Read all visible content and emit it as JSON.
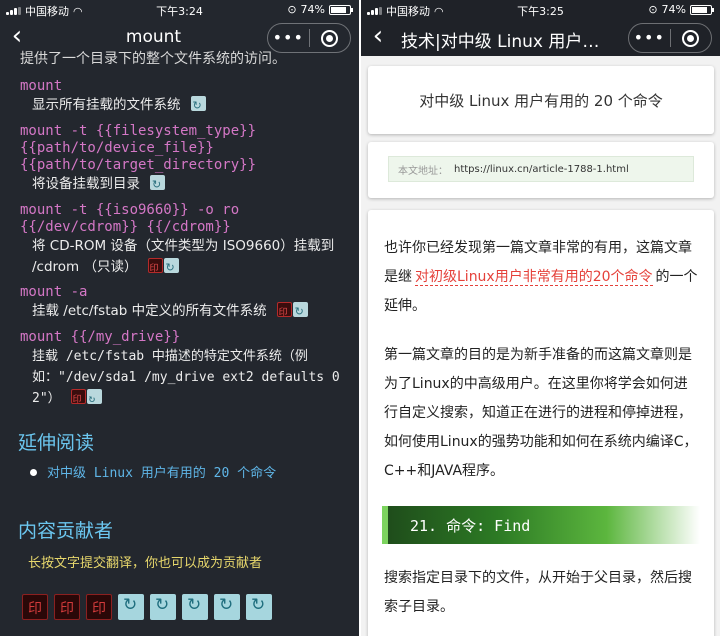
{
  "left": {
    "status": {
      "carrier": "中国移动",
      "time": "下午3:24",
      "battery": "74%",
      "battery_level": 0.74
    },
    "nav": {
      "back": "‹",
      "title": "mount",
      "more": "•••"
    },
    "cut_line": "提供了一个目录下的整个文件系统的访问。",
    "entries": [
      {
        "command": "mount",
        "desc": "显示所有挂载的文件系统"
      },
      {
        "command": "mount -t {{filesystem_type}}\n{{path/to/device_file}}\n{{path/to/target_directory}}",
        "desc": "将设备挂载到目录"
      },
      {
        "command": "mount -t {{iso9660}} -o ro\n{{/dev/cdrom}} {{/cdrom}}",
        "desc": "将 CD-ROM 设备（文件类型为 ISO9660）挂载到 /cdrom （只读）"
      },
      {
        "command": "mount -a",
        "desc": "挂载 /etc/fstab 中定义的所有文件系统"
      },
      {
        "command": "mount {{/my_drive}}",
        "desc": "挂载 /etc/fstab 中描述的特定文件系统（例如：\"/dev/sda1 /my_drive ext2 defaults 0 2\"）"
      }
    ],
    "further_reading_title": "延伸阅读",
    "further_reading_link": "对中级 Linux 用户有用的 20 个命令",
    "contributors_title": "内容贡献者",
    "contributors_text": "长按文字提交翻译，你也可以成为贡献者"
  },
  "right": {
    "status": {
      "carrier": "中国移动",
      "time": "下午3:25",
      "battery": "74%",
      "battery_level": 0.74
    },
    "nav": {
      "back": "‹",
      "title": "技术|对中级 Linux 用户…",
      "more": "•••"
    },
    "article_title": "对中级 Linux 用户有用的 20 个命令",
    "url_label": "本文地址：",
    "url": "https://linux.cn/article-1788-1.html",
    "para1_a": "也许你已经发现第一篇文章非常的有用，这篇文章是继",
    "para1_link": "对初级Linux用户非常有用的20个命令",
    "para1_b": "的一个延伸。",
    "para2": "第一篇文章的目的是为新手准备的而这篇文章则是为了Linux的中高级用户。在这里你将学会如何进行自定义搜索，知道正在进行的进程和停掉进程，如何使用Linux的强势功能和如何在系统内编译C，C++和JAVA程序。",
    "step_heading": "21. 命令: Find",
    "para3": "搜索指定目录下的文件，从开始于父目录，然后搜索子目录。"
  }
}
